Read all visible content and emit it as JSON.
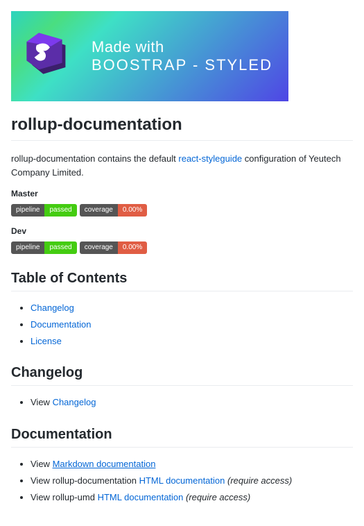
{
  "banner": {
    "line1": "Made with",
    "line2": "BOOSTRAP - STYLED"
  },
  "title": "rollup-documentation",
  "intro": {
    "pre": "rollup-documentation contains the default ",
    "link": "react-styleguide",
    "post": " configuration of Yeutech Company Limited."
  },
  "branches": [
    {
      "label": "Master",
      "pipeline_label": "pipeline",
      "pipeline_value": "passed",
      "coverage_label": "coverage",
      "coverage_value": "0.00%"
    },
    {
      "label": "Dev",
      "pipeline_label": "pipeline",
      "pipeline_value": "passed",
      "coverage_label": "coverage",
      "coverage_value": "0.00%"
    }
  ],
  "toc": {
    "heading": "Table of Contents",
    "items": [
      "Changelog",
      "Documentation",
      "License"
    ]
  },
  "changelog": {
    "heading": "Changelog",
    "item_pre": "View ",
    "item_link": "Changelog"
  },
  "documentation": {
    "heading": "Documentation",
    "items": [
      {
        "pre": "View ",
        "link": "Markdown documentation",
        "post": "",
        "underline": true
      },
      {
        "pre": "View rollup-documentation ",
        "link": "HTML documentation",
        "post": " (require access)",
        "underline": false
      },
      {
        "pre": "View rollup-umd ",
        "link": "HTML documentation",
        "post": " (require access)",
        "underline": false
      }
    ]
  }
}
